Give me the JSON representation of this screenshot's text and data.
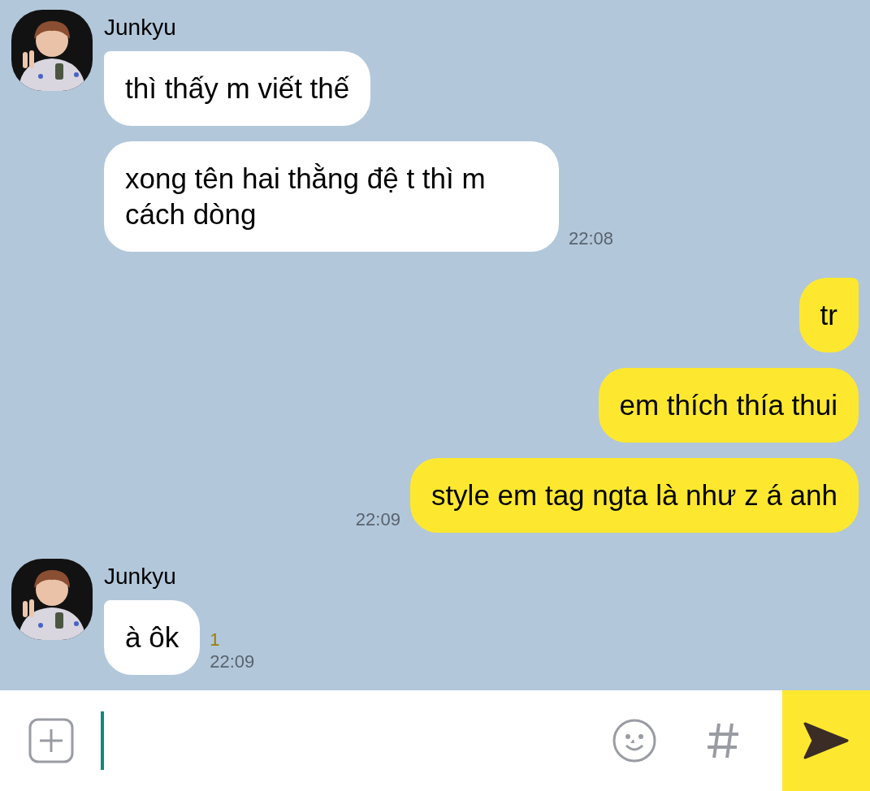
{
  "messages": [
    {
      "kind": "incoming",
      "sender": "Junkyu",
      "bubbles": [
        {
          "text": "thì thấy m viết thế"
        },
        {
          "text": "xong tên hai thằng đệ t thì m cách dòng",
          "time": "22:08"
        }
      ]
    },
    {
      "kind": "outgoing",
      "bubbles": [
        {
          "text": "tr"
        },
        {
          "text": "em thích thía thui"
        },
        {
          "text": "style em tag ngta là như z á anh",
          "time": "22:09"
        }
      ]
    },
    {
      "kind": "incoming",
      "sender": "Junkyu",
      "bubbles": [
        {
          "text": "à ôk",
          "unread": "1",
          "time": "22:09"
        }
      ]
    }
  ],
  "composer": {
    "send_enabled": true
  }
}
